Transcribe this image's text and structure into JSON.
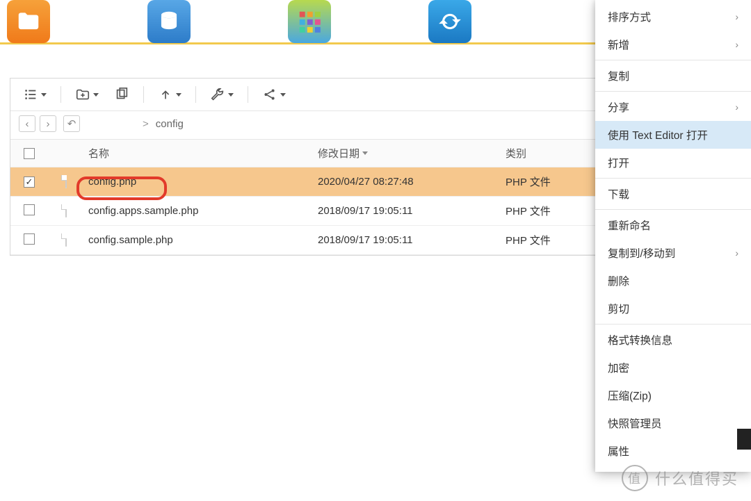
{
  "breadcrumb": {
    "current": "config",
    "sep": ">"
  },
  "columns": {
    "name": "名称",
    "modified": "修改日期",
    "type": "类别"
  },
  "rows": [
    {
      "checked": true,
      "name": "config.php",
      "modified": "2020/04/27 08:27:48",
      "type": "PHP 文件",
      "selected": true
    },
    {
      "checked": false,
      "name": "config.apps.sample.php",
      "modified": "2018/09/17 19:05:11",
      "type": "PHP 文件",
      "selected": false
    },
    {
      "checked": false,
      "name": "config.sample.php",
      "modified": "2018/09/17 19:05:11",
      "type": "PHP 文件",
      "selected": false
    }
  ],
  "context_menu": {
    "sort": "排序方式",
    "new": "新增",
    "copy": "复制",
    "share": "分享",
    "open_te": "使用 Text Editor 打开",
    "open": "打开",
    "download": "下载",
    "rename": "重新命名",
    "copymove": "复制到/移动到",
    "delete": "删除",
    "cut": "剪切",
    "convinfo": "格式转换信息",
    "encrypt": "加密",
    "zip": "压缩(Zip)",
    "snapshot": "快照管理员",
    "props": "属性"
  },
  "watermark": {
    "badge": "值",
    "text": "什么值得买"
  }
}
